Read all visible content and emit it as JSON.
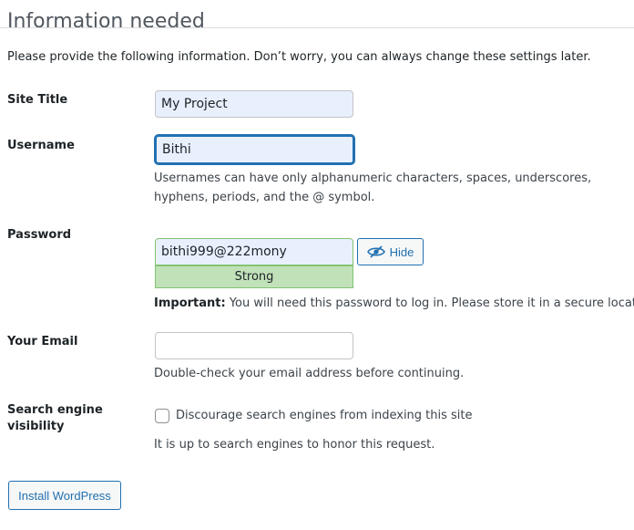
{
  "heading": "Information needed",
  "intro": "Please provide the following information. Don’t worry, you can always change these settings later.",
  "site_title": {
    "label": "Site Title",
    "value": "My Project"
  },
  "username": {
    "label": "Username",
    "value": "Bithi",
    "description": "Usernames can have only alphanumeric characters, spaces, underscores, hyphens, periods, and the @ symbol."
  },
  "password": {
    "label": "Password",
    "value": "bithi999@222mony",
    "hide_label": "Hide",
    "strength": "Strong",
    "important_prefix": "Important:",
    "important_text": " You will need this password to log in. Please store it in a secure location.",
    "hide_icon": "eye-slash-icon",
    "strength_color": "#c1e1b9"
  },
  "email": {
    "label": "Your Email",
    "value": "",
    "description": "Double-check your email address before continuing."
  },
  "search_visibility": {
    "label": "Search engine visibility",
    "checkbox_label": "Discourage search engines from indexing this site",
    "checked": false,
    "description": "It is up to search engines to honor this request."
  },
  "install_button": "Install WordPress",
  "accent_color": "#2271b1"
}
